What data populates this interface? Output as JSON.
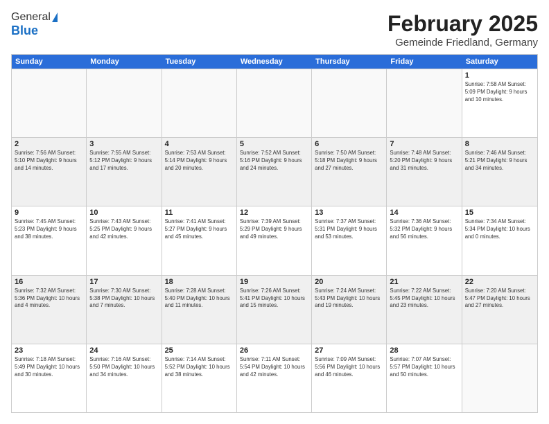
{
  "header": {
    "logo_general": "General",
    "logo_blue": "Blue",
    "title": "February 2025",
    "subtitle": "Gemeinde Friedland, Germany"
  },
  "calendar": {
    "weekdays": [
      "Sunday",
      "Monday",
      "Tuesday",
      "Wednesday",
      "Thursday",
      "Friday",
      "Saturday"
    ],
    "rows": [
      [
        {
          "day": "",
          "info": "",
          "empty": true
        },
        {
          "day": "",
          "info": "",
          "empty": true
        },
        {
          "day": "",
          "info": "",
          "empty": true
        },
        {
          "day": "",
          "info": "",
          "empty": true
        },
        {
          "day": "",
          "info": "",
          "empty": true
        },
        {
          "day": "",
          "info": "",
          "empty": true
        },
        {
          "day": "1",
          "info": "Sunrise: 7:58 AM\nSunset: 5:09 PM\nDaylight: 9 hours\nand 10 minutes.",
          "empty": false
        }
      ],
      [
        {
          "day": "2",
          "info": "Sunrise: 7:56 AM\nSunset: 5:10 PM\nDaylight: 9 hours\nand 14 minutes.",
          "empty": false
        },
        {
          "day": "3",
          "info": "Sunrise: 7:55 AM\nSunset: 5:12 PM\nDaylight: 9 hours\nand 17 minutes.",
          "empty": false
        },
        {
          "day": "4",
          "info": "Sunrise: 7:53 AM\nSunset: 5:14 PM\nDaylight: 9 hours\nand 20 minutes.",
          "empty": false
        },
        {
          "day": "5",
          "info": "Sunrise: 7:52 AM\nSunset: 5:16 PM\nDaylight: 9 hours\nand 24 minutes.",
          "empty": false
        },
        {
          "day": "6",
          "info": "Sunrise: 7:50 AM\nSunset: 5:18 PM\nDaylight: 9 hours\nand 27 minutes.",
          "empty": false
        },
        {
          "day": "7",
          "info": "Sunrise: 7:48 AM\nSunset: 5:20 PM\nDaylight: 9 hours\nand 31 minutes.",
          "empty": false
        },
        {
          "day": "8",
          "info": "Sunrise: 7:46 AM\nSunset: 5:21 PM\nDaylight: 9 hours\nand 34 minutes.",
          "empty": false
        }
      ],
      [
        {
          "day": "9",
          "info": "Sunrise: 7:45 AM\nSunset: 5:23 PM\nDaylight: 9 hours\nand 38 minutes.",
          "empty": false
        },
        {
          "day": "10",
          "info": "Sunrise: 7:43 AM\nSunset: 5:25 PM\nDaylight: 9 hours\nand 42 minutes.",
          "empty": false
        },
        {
          "day": "11",
          "info": "Sunrise: 7:41 AM\nSunset: 5:27 PM\nDaylight: 9 hours\nand 45 minutes.",
          "empty": false
        },
        {
          "day": "12",
          "info": "Sunrise: 7:39 AM\nSunset: 5:29 PM\nDaylight: 9 hours\nand 49 minutes.",
          "empty": false
        },
        {
          "day": "13",
          "info": "Sunrise: 7:37 AM\nSunset: 5:31 PM\nDaylight: 9 hours\nand 53 minutes.",
          "empty": false
        },
        {
          "day": "14",
          "info": "Sunrise: 7:36 AM\nSunset: 5:32 PM\nDaylight: 9 hours\nand 56 minutes.",
          "empty": false
        },
        {
          "day": "15",
          "info": "Sunrise: 7:34 AM\nSunset: 5:34 PM\nDaylight: 10 hours\nand 0 minutes.",
          "empty": false
        }
      ],
      [
        {
          "day": "16",
          "info": "Sunrise: 7:32 AM\nSunset: 5:36 PM\nDaylight: 10 hours\nand 4 minutes.",
          "empty": false
        },
        {
          "day": "17",
          "info": "Sunrise: 7:30 AM\nSunset: 5:38 PM\nDaylight: 10 hours\nand 7 minutes.",
          "empty": false
        },
        {
          "day": "18",
          "info": "Sunrise: 7:28 AM\nSunset: 5:40 PM\nDaylight: 10 hours\nand 11 minutes.",
          "empty": false
        },
        {
          "day": "19",
          "info": "Sunrise: 7:26 AM\nSunset: 5:41 PM\nDaylight: 10 hours\nand 15 minutes.",
          "empty": false
        },
        {
          "day": "20",
          "info": "Sunrise: 7:24 AM\nSunset: 5:43 PM\nDaylight: 10 hours\nand 19 minutes.",
          "empty": false
        },
        {
          "day": "21",
          "info": "Sunrise: 7:22 AM\nSunset: 5:45 PM\nDaylight: 10 hours\nand 23 minutes.",
          "empty": false
        },
        {
          "day": "22",
          "info": "Sunrise: 7:20 AM\nSunset: 5:47 PM\nDaylight: 10 hours\nand 27 minutes.",
          "empty": false
        }
      ],
      [
        {
          "day": "23",
          "info": "Sunrise: 7:18 AM\nSunset: 5:49 PM\nDaylight: 10 hours\nand 30 minutes.",
          "empty": false
        },
        {
          "day": "24",
          "info": "Sunrise: 7:16 AM\nSunset: 5:50 PM\nDaylight: 10 hours\nand 34 minutes.",
          "empty": false
        },
        {
          "day": "25",
          "info": "Sunrise: 7:14 AM\nSunset: 5:52 PM\nDaylight: 10 hours\nand 38 minutes.",
          "empty": false
        },
        {
          "day": "26",
          "info": "Sunrise: 7:11 AM\nSunset: 5:54 PM\nDaylight: 10 hours\nand 42 minutes.",
          "empty": false
        },
        {
          "day": "27",
          "info": "Sunrise: 7:09 AM\nSunset: 5:56 PM\nDaylight: 10 hours\nand 46 minutes.",
          "empty": false
        },
        {
          "day": "28",
          "info": "Sunrise: 7:07 AM\nSunset: 5:57 PM\nDaylight: 10 hours\nand 50 minutes.",
          "empty": false
        },
        {
          "day": "",
          "info": "",
          "empty": true
        }
      ]
    ]
  }
}
